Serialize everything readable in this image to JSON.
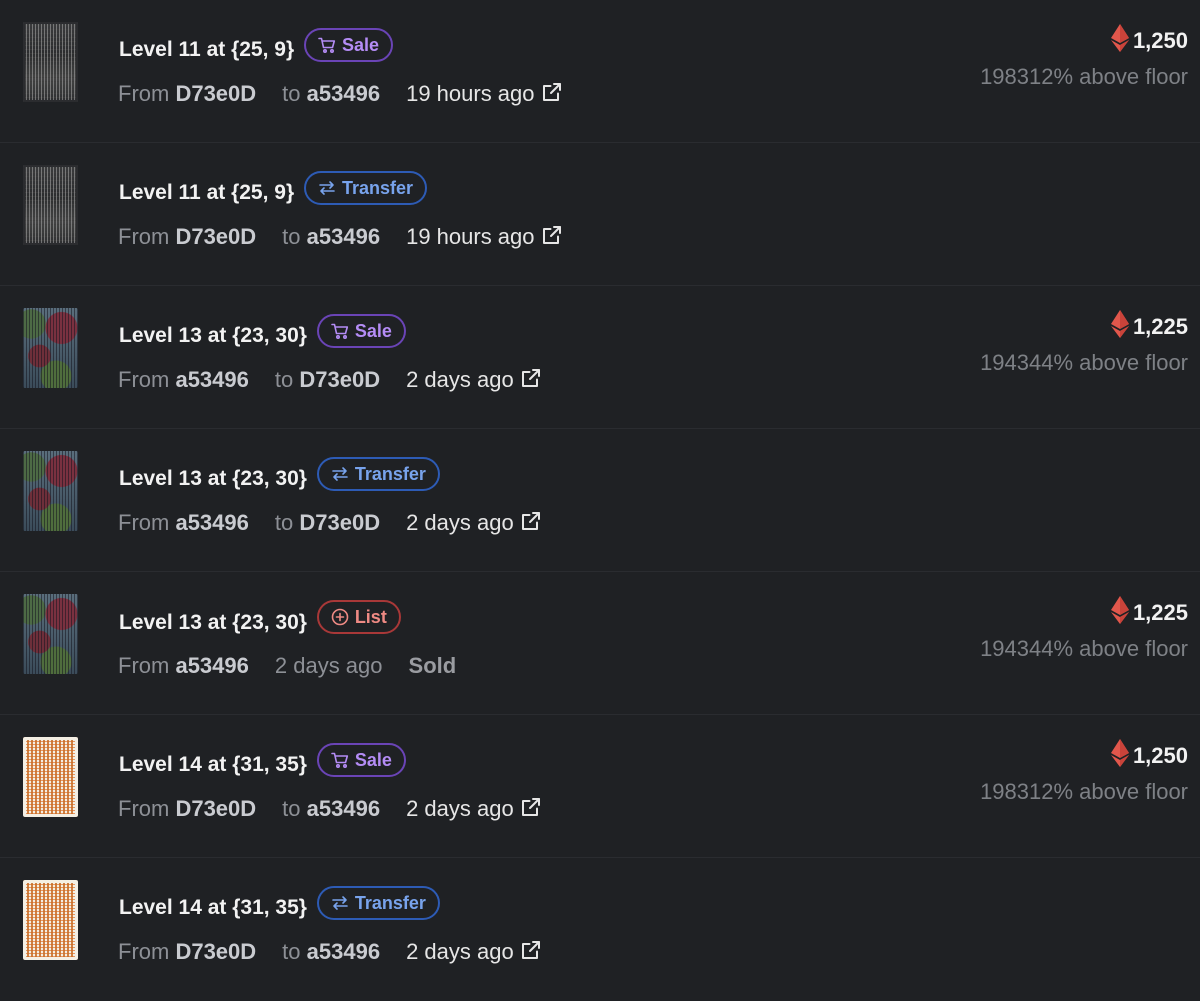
{
  "activity": [
    {
      "thumb": "dark",
      "title": "Level 11 at {25, 9}",
      "badge": {
        "type": "sale",
        "label": "Sale",
        "icon": "cart-icon"
      },
      "from_label": "From",
      "from": "D73e0D",
      "to_label": "to",
      "to": "a53496",
      "time": "19 hours ago",
      "price": {
        "amount": "1,250",
        "floor": "198312% above floor"
      }
    },
    {
      "thumb": "dark",
      "title": "Level 11 at {25, 9}",
      "badge": {
        "type": "transfer",
        "label": "Transfer",
        "icon": "transfer-arrows-icon"
      },
      "from_label": "From",
      "from": "D73e0D",
      "to_label": "to",
      "to": "a53496",
      "time": "19 hours ago"
    },
    {
      "thumb": "camo",
      "title": "Level 13 at {23, 30}",
      "badge": {
        "type": "sale",
        "label": "Sale",
        "icon": "cart-icon"
      },
      "from_label": "From",
      "from": "a53496",
      "to_label": "to",
      "to": "D73e0D",
      "time": "2 days ago",
      "price": {
        "amount": "1,225",
        "floor": "194344% above floor"
      }
    },
    {
      "thumb": "camo",
      "title": "Level 13 at {23, 30}",
      "badge": {
        "type": "transfer",
        "label": "Transfer",
        "icon": "transfer-arrows-icon"
      },
      "from_label": "From",
      "from": "a53496",
      "to_label": "to",
      "to": "D73e0D",
      "time": "2 days ago"
    },
    {
      "thumb": "camo",
      "title": "Level 13 at {23, 30}",
      "badge": {
        "type": "list",
        "label": "List",
        "icon": "plus-circle-icon"
      },
      "from_label": "From",
      "from": "a53496",
      "time": "2 days ago",
      "status": "Sold",
      "price": {
        "amount": "1,225",
        "floor": "194344% above floor"
      }
    },
    {
      "thumb": "peach",
      "title": "Level 14 at {31, 35}",
      "badge": {
        "type": "sale",
        "label": "Sale",
        "icon": "cart-icon"
      },
      "from_label": "From",
      "from": "D73e0D",
      "to_label": "to",
      "to": "a53496",
      "time": "2 days ago",
      "price": {
        "amount": "1,250",
        "floor": "198312% above floor"
      }
    },
    {
      "thumb": "peach",
      "title": "Level 14 at {31, 35}",
      "badge": {
        "type": "transfer",
        "label": "Transfer",
        "icon": "transfer-arrows-icon"
      },
      "from_label": "From",
      "from": "D73e0D",
      "to_label": "to",
      "to": "a53496",
      "time": "2 days ago"
    }
  ],
  "colors": {
    "background": "#1f2124",
    "sale": "#b48cf5",
    "transfer": "#78a3ec",
    "list": "#ef8a84",
    "eth": "#e2574c"
  }
}
